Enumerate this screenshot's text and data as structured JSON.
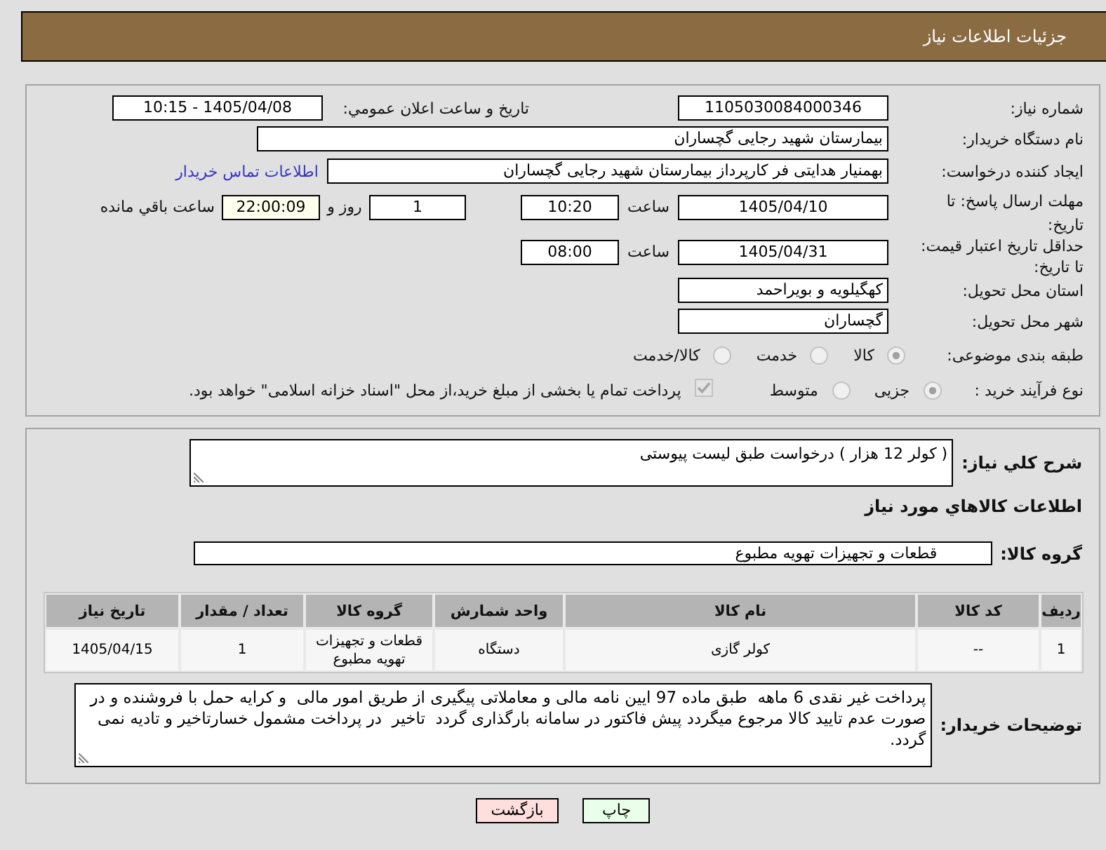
{
  "header": {
    "title": "جزئیات اطلاعات نیاز"
  },
  "need_info": {
    "need_number": {
      "label": "شماره نیاز:",
      "value": "1105030084000346"
    },
    "announcement": {
      "label": "تاریخ و ساعت اعلان عمومي:",
      "value": "1405/04/08 - 10:15"
    },
    "buyer_org": {
      "label": "نام دستگاه خریدار:",
      "value": "بیمارستان شهید رجایی گچساران"
    },
    "requester": {
      "label": "ایجاد کننده درخواست:",
      "value": "بهمنیار هدایتی فر کارپرداز بیمارستان شهید رجایی گچساران",
      "contact_link": "اطلاعات تماس خریدار"
    },
    "response_deadline": {
      "label": "مهلت ارسال پاسخ: تا تاریخ:",
      "date": "1405/04/10",
      "time_label": "ساعت",
      "time": "10:20",
      "days": "1",
      "days_label": "روز و",
      "remaining": "22:00:09",
      "remaining_label": "ساعت باقي مانده"
    },
    "price_validity": {
      "label": "حداقل تاریخ اعتبار قیمت: تا تاریخ:",
      "date": "1405/04/31",
      "time_label": "ساعت",
      "time": "08:00"
    },
    "delivery_province": {
      "label": "استان محل تحویل:",
      "value": "کهگیلویه و بویراحمد"
    },
    "delivery_city": {
      "label": "شهر محل تحویل:",
      "value": "گچساران"
    },
    "subject_category": {
      "label": "طبقه بندی موضوعی:",
      "options": [
        {
          "label": "کالا",
          "selected": true
        },
        {
          "label": "خدمت",
          "selected": false
        },
        {
          "label": "کالا/خدمت",
          "selected": false
        }
      ]
    },
    "purchase_process": {
      "label": "نوع فرآیند خرید :",
      "options": [
        {
          "label": "جزیی",
          "selected": true
        },
        {
          "label": "متوسط",
          "selected": false
        }
      ],
      "treasury_payment": {
        "label": "پرداخت تمام یا بخشی از مبلغ خرید،از محل \"اسناد خزانه اسلامی\" خواهد بود.",
        "checked": true
      }
    }
  },
  "goods": {
    "description": {
      "label": "شرح کلي نياز:",
      "value": "( کولر 12 هزار ) درخواست طبق لیست پیوستی"
    },
    "section_title": "اطلاعات کالاهاي مورد نياز",
    "goods_group": {
      "label": "گروه کالا:",
      "value": "قطعات و تجهیزات تهویه مطبوع"
    },
    "table": {
      "columns": [
        "ردیف",
        "کد کالا",
        "نام کالا",
        "واحد شمارش",
        "گروه کالا",
        "تعداد / مقدار",
        "تاریخ نیاز"
      ],
      "rows": [
        [
          "1",
          "--",
          "کولر گازی",
          "دستگاه",
          "قطعات و تجهیزات تهویه مطبوع",
          "1",
          "1405/04/15"
        ]
      ]
    },
    "buyer_notes": {
      "label": "توضیحات خریدار:",
      "value": "پرداخت غیر نقدی 6 ماهه  طبق ماده 97 ایین نامه مالی و معاملاتی پیگیری از طریق امور مالی  و کرایه حمل با فروشنده و در صورت عدم تایید کالا مرجوع میگردد پیش فاکتور در سامانه بارگذاری گردد  تاخیر  در پرداخت مشمول خسارتاخیر و تادیه نمی گردد."
    }
  },
  "buttons": [
    {
      "label": "چاپ",
      "kind": "print"
    },
    {
      "label": "بازگشت",
      "kind": "back"
    }
  ]
}
